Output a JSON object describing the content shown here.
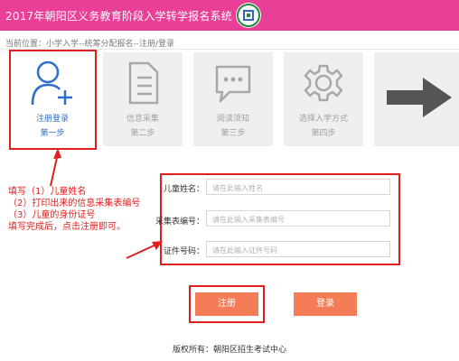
{
  "header": {
    "title": "2017年朝阳区义务教育阶段入学转学报名系统"
  },
  "breadcrumb": "当前位置：小学入学--统筹分配报名--注册/登录",
  "steps": [
    {
      "label": "注册登录",
      "sub": "第一步",
      "icon": "user-add-icon",
      "active": true
    },
    {
      "label": "信息采集",
      "sub": "第二步",
      "icon": "document-icon",
      "active": false
    },
    {
      "label": "阅读须知",
      "sub": "第三步",
      "icon": "chat-bubble-icon",
      "active": false
    },
    {
      "label": "选择入学方式",
      "sub": "第四步",
      "icon": "gear-icon",
      "active": false
    }
  ],
  "next_arrow_icon": "arrow-right-icon",
  "instructions": [
    "填写（1）儿童姓名",
    "（2）打印出来的信息采集表编号",
    "（3）儿童的身份证号",
    "填写完成后，点击注册即可。"
  ],
  "form": {
    "child_name_label": "儿童姓名：",
    "child_name_placeholder": "请在此输入姓名",
    "form_no_label": "采集表编号：",
    "form_no_placeholder": "请在此输入采集表编号",
    "id_label": "证件号码：",
    "id_placeholder": "请在此输入证件号码"
  },
  "buttons": {
    "register": "注册",
    "login": "登录"
  },
  "footer": "版权所有：朝阳区招生考试中心",
  "colors": {
    "header": "#ea3f96",
    "active_step": "#2f6ecb",
    "button": "#f47c57",
    "annotation": "#e02020"
  }
}
